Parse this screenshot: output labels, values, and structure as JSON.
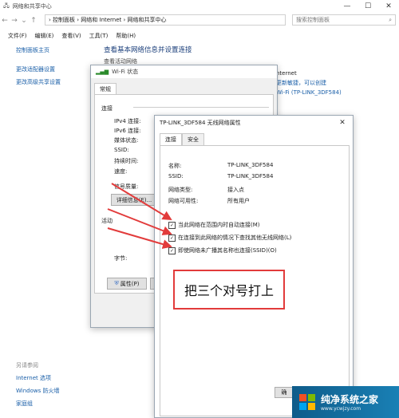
{
  "main_window": {
    "title": "网络和共享中心",
    "controls": [
      "—",
      "☐",
      "✕"
    ],
    "breadcrumb": "› 控制面板 › 网络和 Internet › 网络和共享中心",
    "search_placeholder": "搜索控制面板",
    "menu": [
      "文件(F)",
      "编辑(E)",
      "查看(V)",
      "工具(T)",
      "帮助(H)"
    ],
    "sidebar": {
      "home": "控制面板主页",
      "items": [
        "更改适配器设置",
        "更改高级共享设置"
      ]
    },
    "see_also": {
      "header": "另请参阅",
      "links": [
        "Internet 选项",
        "Windows 防火墙",
        "家庭组"
      ]
    },
    "heading": "查看基本网络信息并设置连接",
    "subheading": "查看活动网络",
    "right_info": {
      "line1": "nternet",
      "line2": "更新敏捷，可以创建",
      "line3": "Wi-Fi (TP-LINK_3DF584)"
    }
  },
  "wifi_status": {
    "title": "Wi-Fi 状态",
    "tab": "常规",
    "connection_group": "连接",
    "rows": [
      "IPv4 连接:",
      "IPv6 连接:",
      "媒体状态:",
      "SSID:",
      "持续时间:",
      "速度:"
    ],
    "signal_label": "信号质量:",
    "details_button": "详细信息(E)...",
    "activity_group": "活动",
    "bytes_label": "字节:",
    "properties_button": "属性(P)"
  },
  "properties": {
    "title": "TP-LINK_3DF584 无线网络属性",
    "close": "✕",
    "tabs": [
      "连接",
      "安全"
    ],
    "info": [
      {
        "label": "名称:",
        "value": "TP-LINK_3DF584"
      },
      {
        "label": "SSID:",
        "value": "TP-LINK_3DF584"
      },
      {
        "label": "网络类型:",
        "value": "接入点"
      },
      {
        "label": "网络可用性:",
        "value": "所有用户"
      }
    ],
    "checkboxes": [
      {
        "label": "当此网络在范围内时自动连接(M)",
        "checked": true
      },
      {
        "label": "在连接到此网络的情况下查找其他无线网络(L)",
        "checked": true
      },
      {
        "label": "即使网络未广播其名称也连接(SSID)(O)",
        "checked": true
      }
    ],
    "ok_button": "确"
  },
  "annotation": {
    "text": "把三个对号打上",
    "border_color": "#e23b3b",
    "arrow_color": "#e23b3b"
  },
  "watermark": {
    "title": "纯净系统之家",
    "url": "www.ycwjzy.com"
  }
}
